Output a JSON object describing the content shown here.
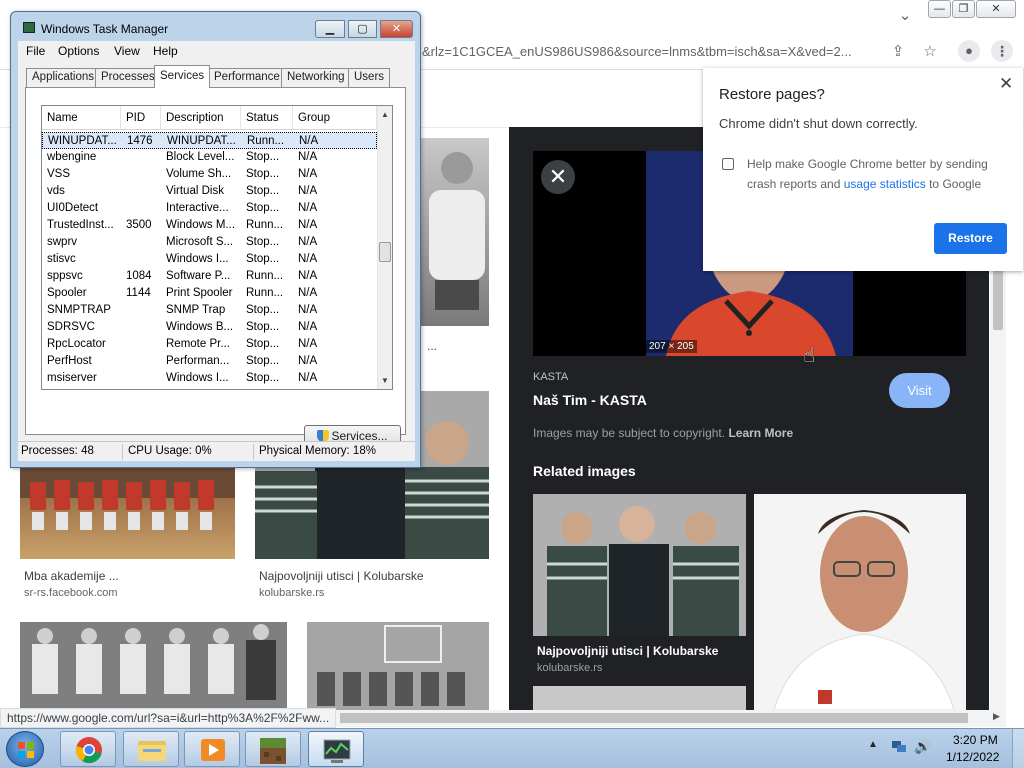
{
  "chrome": {
    "omnibox_url": "&rlz=1C1GCEA_enUS986US986&source=lnms&tbm=isch&sa=X&ved=2...",
    "window_controls": {
      "minimize": "—",
      "restore": "❐",
      "close": "✕"
    },
    "status_url": "https://www.google.com/url?sa=i&url=http%3A%2F%2Fww...",
    "icons": {
      "dropdown": "chevron-down-icon",
      "share": "share-icon",
      "star": "star-icon",
      "profile": "person-icon",
      "menu": "kebab-menu-icon"
    },
    "grid": [
      {
        "caption": "Mba akademije ...",
        "source": "sr-rs.facebook.com"
      },
      {
        "caption": "Najpovoljniji utisci | Kolubarske",
        "source": "kolubarske.rs"
      }
    ],
    "truncated_caption": "..."
  },
  "preview": {
    "close_label": "✕",
    "size": "207 × 205",
    "source": "KASTA",
    "title": "Naš Tim - KASTA",
    "visit_label": "Visit",
    "copyright": "Images may be subject to copyright. ",
    "copyright_link": "Learn More",
    "related_heading": "Related images",
    "related": [
      {
        "title": "Najpovoljniji utisci | Kolubarske",
        "source": "kolubarske.rs"
      }
    ]
  },
  "restore_popup": {
    "title": "Restore pages?",
    "message": "Chrome didn't shut down correctly.",
    "close_label": "✕",
    "checkbox_text": "Help make Google Chrome better by sending crash reports and ",
    "checkbox_link": "usage statistics",
    "checkbox_text_after": " to Google",
    "button_label": "Restore"
  },
  "taskmgr": {
    "title": "Windows Task Manager",
    "menus": [
      "File",
      "Options",
      "View",
      "Help"
    ],
    "tabs": [
      "Applications",
      "Processes",
      "Services",
      "Performance",
      "Networking",
      "Users"
    ],
    "active_tab": "Services",
    "columns": [
      "Name",
      "PID",
      "Description",
      "Status",
      "Group"
    ],
    "rows": [
      {
        "name": "WINUPDAT...",
        "pid": "1476",
        "desc": "WINUPDAT...",
        "status": "Runn...",
        "group": "N/A"
      },
      {
        "name": "wbengine",
        "pid": "",
        "desc": "Block Level...",
        "status": "Stop...",
        "group": "N/A"
      },
      {
        "name": "VSS",
        "pid": "",
        "desc": "Volume Sh...",
        "status": "Stop...",
        "group": "N/A"
      },
      {
        "name": "vds",
        "pid": "",
        "desc": "Virtual Disk",
        "status": "Stop...",
        "group": "N/A"
      },
      {
        "name": "UI0Detect",
        "pid": "",
        "desc": "Interactive...",
        "status": "Stop...",
        "group": "N/A"
      },
      {
        "name": "TrustedInst...",
        "pid": "3500",
        "desc": "Windows M...",
        "status": "Runn...",
        "group": "N/A"
      },
      {
        "name": "swprv",
        "pid": "",
        "desc": "Microsoft S...",
        "status": "Stop...",
        "group": "N/A"
      },
      {
        "name": "stisvc",
        "pid": "",
        "desc": "Windows I...",
        "status": "Stop...",
        "group": "N/A"
      },
      {
        "name": "sppsvc",
        "pid": "1084",
        "desc": "Software P...",
        "status": "Runn...",
        "group": "N/A"
      },
      {
        "name": "Spooler",
        "pid": "1144",
        "desc": "Print Spooler",
        "status": "Runn...",
        "group": "N/A"
      },
      {
        "name": "SNMPTRAP",
        "pid": "",
        "desc": "SNMP Trap",
        "status": "Stop...",
        "group": "N/A"
      },
      {
        "name": "SDRSVC",
        "pid": "",
        "desc": "Windows B...",
        "status": "Stop...",
        "group": "N/A"
      },
      {
        "name": "RpcLocator",
        "pid": "",
        "desc": "Remote Pr...",
        "status": "Stop...",
        "group": "N/A"
      },
      {
        "name": "PerfHost",
        "pid": "",
        "desc": "Performan...",
        "status": "Stop...",
        "group": "N/A"
      },
      {
        "name": "msiserver",
        "pid": "",
        "desc": "Windows I...",
        "status": "Stop...",
        "group": "N/A"
      }
    ],
    "services_button": "Services...",
    "status": {
      "processes": "Processes: 48",
      "cpu": "CPU Usage: 0%",
      "memory": "Physical Memory: 18%"
    }
  },
  "taskbar": {
    "apps": [
      "chrome-icon",
      "file-explorer-icon",
      "media-player-icon",
      "minecraft-icon",
      "task-manager-icon"
    ],
    "clock_time": "3:20 PM",
    "clock_date": "1/12/2022",
    "tray_arrow": "▲",
    "volume_icon": "🔊"
  }
}
